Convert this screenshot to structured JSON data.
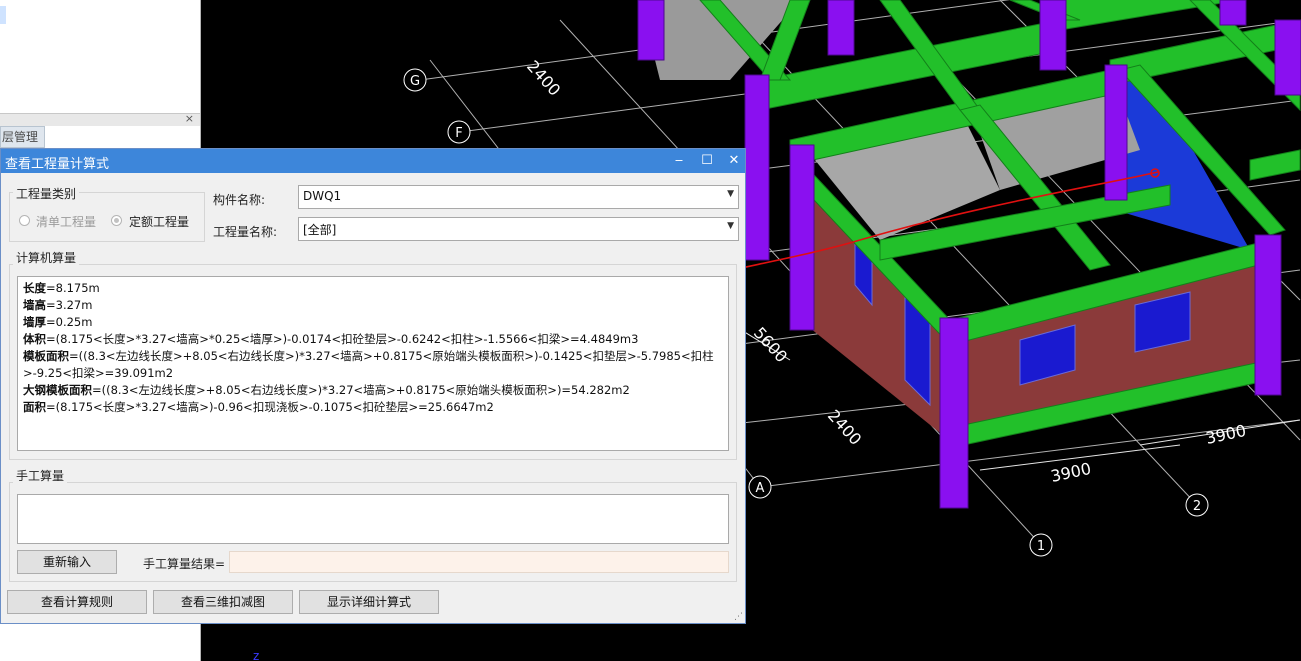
{
  "viewport": {
    "grid_labels": [
      "G",
      "F",
      "A",
      "1",
      "2"
    ],
    "dimensions": [
      "2400",
      "5600",
      "2400",
      "3900",
      "3900"
    ],
    "bottom_mark": "z"
  },
  "left_panel": {
    "tab_label": "层管理",
    "close_glyph": "×"
  },
  "dialog": {
    "title": "查看工程量计算式",
    "controls": {
      "minimize": "‒",
      "maximize": "☐",
      "close": "✕"
    },
    "category_group": {
      "legend": "工程量类别",
      "options": [
        {
          "label": "清单工程量",
          "selected": false,
          "disabled": true
        },
        {
          "label": "定额工程量",
          "selected": true,
          "disabled": false
        }
      ]
    },
    "component_name": {
      "label": "构件名称:",
      "value": "DWQ1"
    },
    "quantity_name": {
      "label": "工程量名称:",
      "value": "[全部]"
    },
    "computer_calc": {
      "legend": "计算机算量",
      "lines": [
        {
          "key": "长度",
          "text": "=8.175m"
        },
        {
          "key": "墙高",
          "text": "=3.27m"
        },
        {
          "key": "墙厚",
          "text": "=0.25m"
        },
        {
          "key": "体积",
          "text": "=(8.175<长度>*3.27<墙高>*0.25<墙厚>)-0.0174<扣砼垫层>-0.6242<扣柱>-1.5566<扣梁>=4.4849m3"
        },
        {
          "key": "模板面积",
          "text": "=((8.3<左边线长度>+8.05<右边线长度>)*3.27<墙高>+0.8175<原始端头模板面积>)-0.1425<扣垫层>-5.7985<扣柱>-9.25<扣梁>=39.091m2"
        },
        {
          "key": "大钢模板面积",
          "text": "=((8.3<左边线长度>+8.05<右边线长度>)*3.27<墙高>+0.8175<原始端头模板面积>)=54.282m2"
        },
        {
          "key": "面积",
          "text": "=(8.175<长度>*3.27<墙高>)-0.96<扣现浇板>-0.1075<扣砼垫层>=25.6647m2"
        }
      ]
    },
    "manual_calc": {
      "legend": "手工算量",
      "input_value": "",
      "reenter_button": "重新输入",
      "result_label": "手工算量结果=",
      "result_value": ""
    },
    "footer_buttons": {
      "view_rules": "查看计算规则",
      "view_3d": "查看三维扣减图",
      "show_detail": "显示详细计算式"
    }
  },
  "colors": {
    "beam": "#22c02a",
    "column": "#8a10f0",
    "wall": "#8b3a3a",
    "slab": "#9d9d9d",
    "window": "#1a2fd0",
    "grid": "#d8d8d8",
    "annotation": "#e01010",
    "titlebar": "#3d86da"
  }
}
